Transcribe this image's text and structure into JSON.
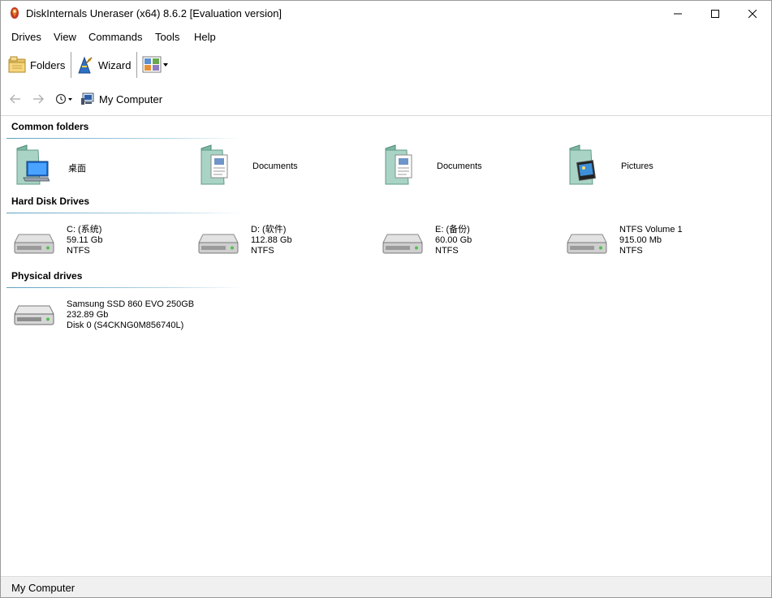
{
  "window": {
    "title": "DiskInternals Uneraser (x64) 8.6.2 [Evaluation version]"
  },
  "menu": {
    "items": [
      "Drives",
      "View",
      "Commands",
      "Tools",
      "Help"
    ]
  },
  "toolbar": {
    "folders_label": "Folders",
    "wizard_label": "Wizard"
  },
  "nav": {
    "location": "My Computer"
  },
  "sections": {
    "common_folders": {
      "title": "Common folders",
      "items": [
        {
          "label": "桌面",
          "icon": "desktop-folder-icon"
        },
        {
          "label": "Documents",
          "icon": "documents-folder-icon"
        },
        {
          "label": "Documents",
          "icon": "documents-folder-icon"
        },
        {
          "label": "Pictures",
          "icon": "pictures-folder-icon"
        }
      ]
    },
    "hard_disk_drives": {
      "title": "Hard Disk Drives",
      "items": [
        {
          "name": "C: (系统)",
          "size": "59.11 Gb",
          "fs": "NTFS",
          "icon": "hard-drive-icon"
        },
        {
          "name": "D: (软件)",
          "size": "112.88 Gb",
          "fs": "NTFS",
          "icon": "hard-drive-icon"
        },
        {
          "name": "E: (备份)",
          "size": "60.00 Gb",
          "fs": "NTFS",
          "icon": "hard-drive-icon"
        },
        {
          "name": "NTFS Volume 1",
          "size": "915.00 Mb",
          "fs": "NTFS",
          "icon": "hard-drive-icon"
        }
      ]
    },
    "physical_drives": {
      "title": "Physical drives",
      "items": [
        {
          "name": "Samsung SSD 860 EVO 250GB",
          "size": "232.89 Gb",
          "detail": "Disk 0 (S4CKNG0M856740L)",
          "icon": "physical-drive-icon"
        }
      ]
    }
  },
  "status": {
    "text": "My Computer"
  },
  "colors": {
    "section_line": "#5ea0c0",
    "statusbar_bg": "#f0f0f0"
  }
}
